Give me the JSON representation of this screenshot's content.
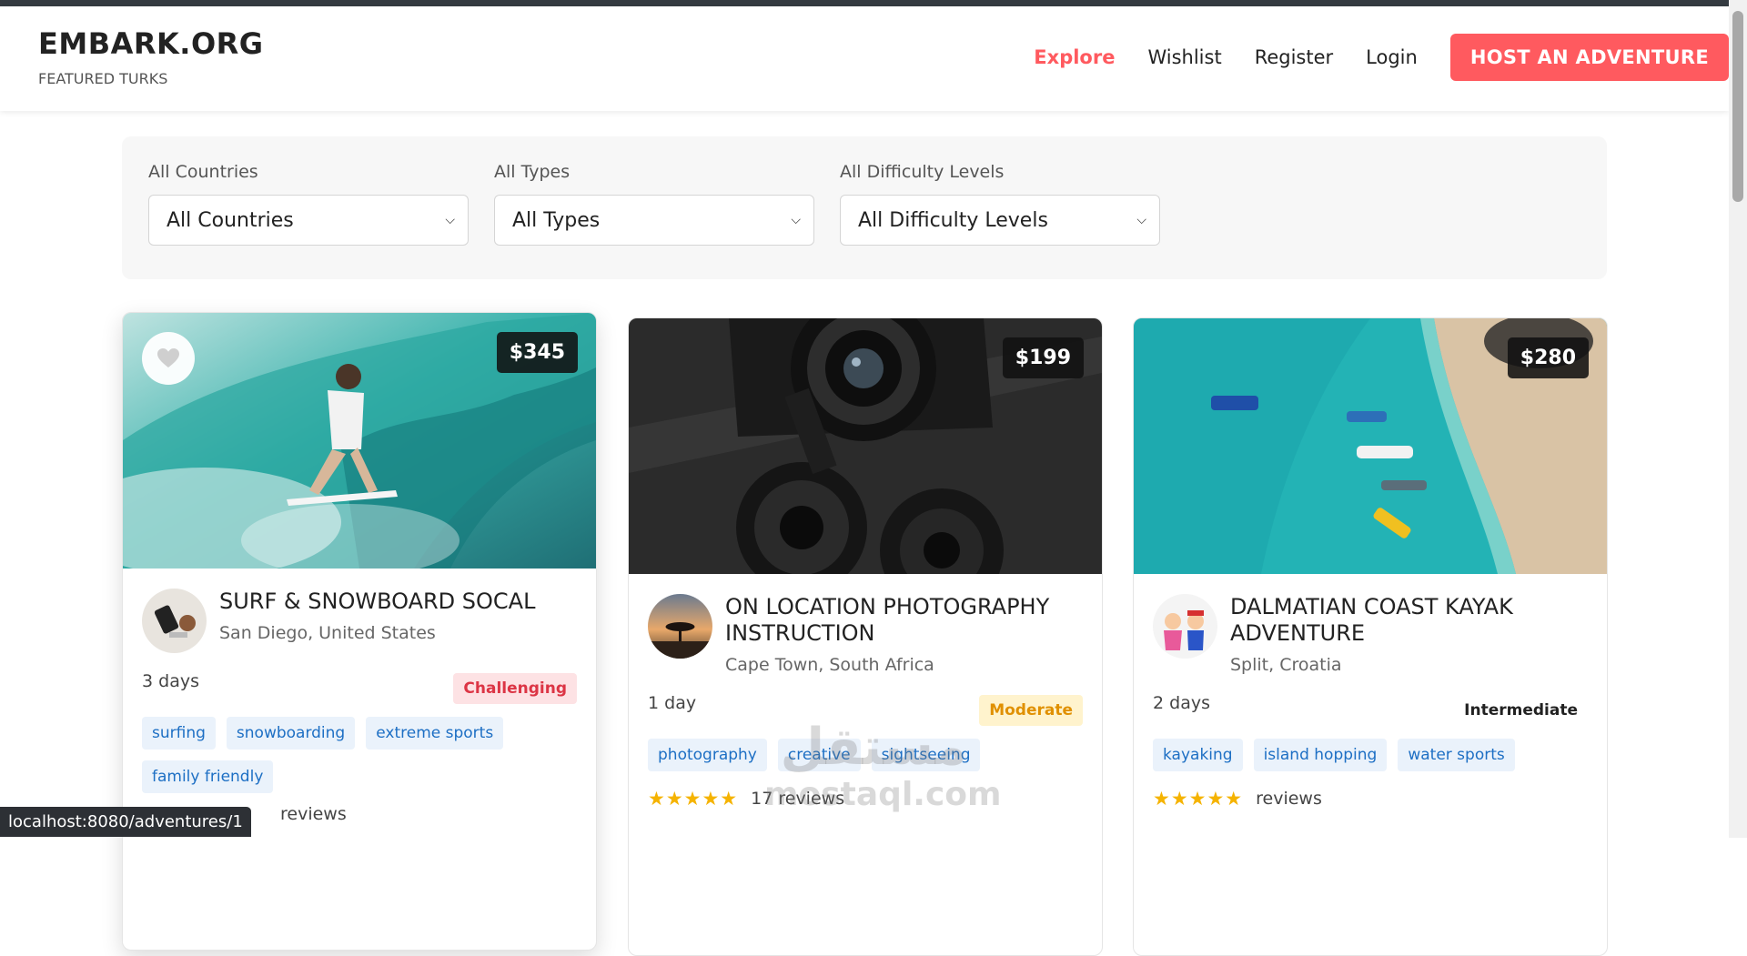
{
  "brand": {
    "title": "EMBARK.ORG",
    "subtitle": "FEATURED TURKS"
  },
  "nav": {
    "explore": "Explore",
    "wishlist": "Wishlist",
    "register": "Register",
    "login": "Login",
    "host": "HOST AN ADVENTURE",
    "accent_color": "#ff5a5f"
  },
  "filters": {
    "country": {
      "label": "All Countries",
      "value": "All Countries"
    },
    "type": {
      "label": "All Types",
      "value": "All Types"
    },
    "difficulty": {
      "label": "All Difficulty Levels",
      "value": "All Difficulty Levels"
    }
  },
  "cards": [
    {
      "price": "$345",
      "title": "SURF & SNOWBOARD SOCAL",
      "location": "San Diego, United States",
      "duration": "3 days",
      "difficulty": "Challenging",
      "tags": [
        "surfing",
        "snowboarding",
        "extreme sports",
        "family friendly"
      ],
      "reviews": "reviews",
      "favorite_icon": "heart-icon"
    },
    {
      "price": "$199",
      "title": "ON LOCATION PHOTOGRAPHY INSTRUCTION",
      "location": "Cape Town, South Africa",
      "duration": "1 day",
      "difficulty": "Moderate",
      "tags": [
        "photography",
        "creative",
        "sightseeing"
      ],
      "stars": "★★★★★",
      "reviews": "17 reviews"
    },
    {
      "price": "$280",
      "title": "DALMATIAN COAST KAYAK ADVENTURE",
      "location": "Split, Croatia",
      "duration": "2 days",
      "difficulty": "Intermediate",
      "tags": [
        "kayaking",
        "island hopping",
        "water sports"
      ],
      "stars": "★★★★★",
      "reviews": "reviews"
    }
  ],
  "status_url": "localhost:8080/adventures/1",
  "watermark": {
    "arabic": "مستقل",
    "latin": "mostaql.com"
  }
}
